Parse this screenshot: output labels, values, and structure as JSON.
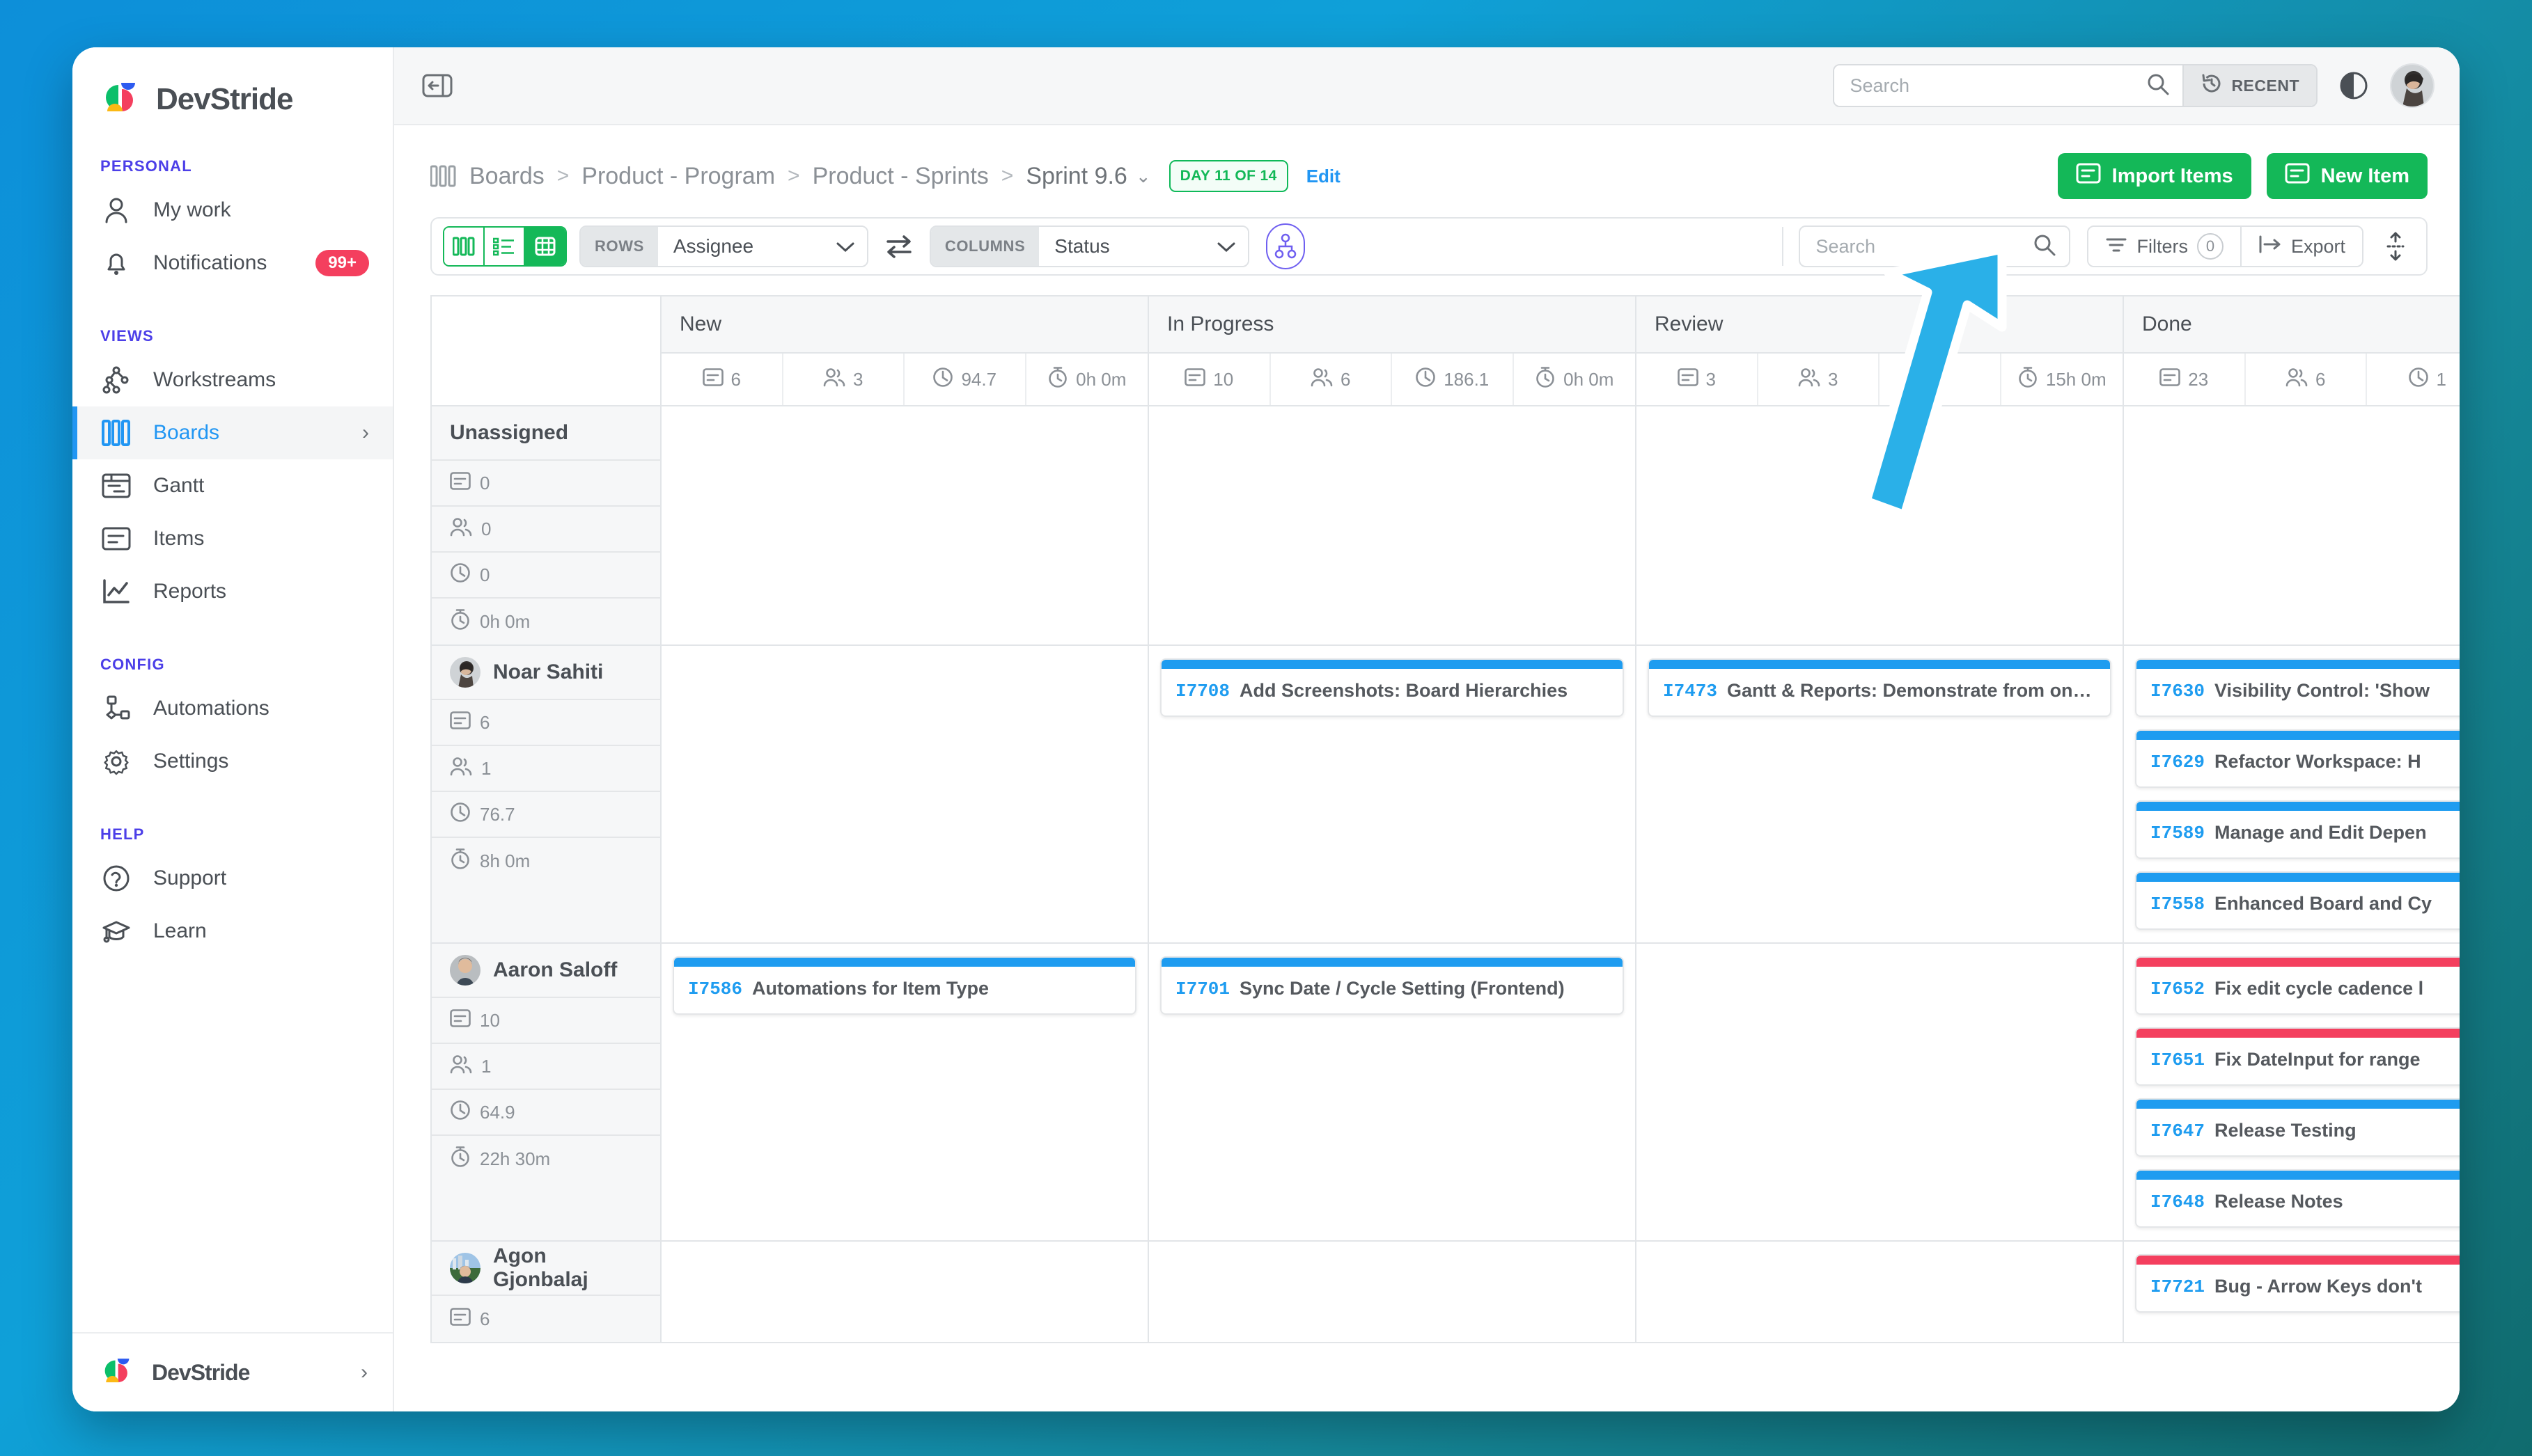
{
  "sidebar": {
    "brand": "DevStride",
    "sections": [
      {
        "label": "PERSONAL",
        "items": [
          {
            "label": "My work",
            "icon": "user-icon",
            "badge": null,
            "active": false,
            "chevron": false
          },
          {
            "label": "Notifications",
            "icon": "bell-icon",
            "badge": "99+",
            "active": false,
            "chevron": false
          }
        ]
      },
      {
        "label": "VIEWS",
        "items": [
          {
            "label": "Workstreams",
            "icon": "workstreams-icon",
            "badge": null,
            "active": false,
            "chevron": false
          },
          {
            "label": "Boards",
            "icon": "boards-icon",
            "badge": null,
            "active": true,
            "chevron": true
          },
          {
            "label": "Gantt",
            "icon": "gantt-icon",
            "badge": null,
            "active": false,
            "chevron": false
          },
          {
            "label": "Items",
            "icon": "items-icon",
            "badge": null,
            "active": false,
            "chevron": false
          },
          {
            "label": "Reports",
            "icon": "reports-icon",
            "badge": null,
            "active": false,
            "chevron": false
          }
        ]
      },
      {
        "label": "CONFIG",
        "items": [
          {
            "label": "Automations",
            "icon": "automations-icon",
            "badge": null,
            "active": false,
            "chevron": false
          },
          {
            "label": "Settings",
            "icon": "gear-icon",
            "badge": null,
            "active": false,
            "chevron": false
          }
        ]
      },
      {
        "label": "HELP",
        "items": [
          {
            "label": "Support",
            "icon": "question-circle-icon",
            "badge": null,
            "active": false,
            "chevron": false
          },
          {
            "label": "Learn",
            "icon": "graduation-cap-icon",
            "badge": null,
            "active": false,
            "chevron": false
          }
        ]
      }
    ],
    "footer": {
      "workspace": "DevStride"
    }
  },
  "topbar": {
    "search_placeholder": "Search",
    "search_value": "",
    "recent_label": "RECENT"
  },
  "breadcrumb": {
    "items": [
      "Boards",
      "Product - Program",
      "Product - Sprints",
      "Sprint 9.6"
    ],
    "separator": ">",
    "caret": "⌄",
    "day_badge": "DAY 11 OF 14",
    "edit_label": "Edit"
  },
  "actions": {
    "import_label": "Import Items",
    "new_item_label": "New Item"
  },
  "toolbar": {
    "rows_label": "ROWS",
    "rows_value": "Assignee",
    "columns_label": "COLUMNS",
    "columns_value": "Status",
    "search_placeholder": "Search",
    "search_value": "",
    "filters_label": "Filters",
    "filters_count": "0",
    "export_label": "Export",
    "view_modes": [
      "board-view",
      "list-view",
      "grid-view"
    ],
    "active_view": "grid-view"
  },
  "board": {
    "columns": [
      {
        "name": "New",
        "stats": {
          "items": "6",
          "people": "3",
          "points": "94.7",
          "time": "0h 0m"
        }
      },
      {
        "name": "In Progress",
        "stats": {
          "items": "10",
          "people": "6",
          "points": "186.1",
          "time": "0h 0m"
        }
      },
      {
        "name": "Review",
        "stats": {
          "items": "3",
          "people": "3",
          "points": "",
          "time": "15h 0m"
        }
      },
      {
        "name": "Done",
        "stats": {
          "items": "23",
          "people": "6",
          "points": "1",
          "time": ""
        }
      }
    ],
    "rows": [
      {
        "name": "Unassigned",
        "has_avatar": false,
        "stats": {
          "items": "0",
          "people": "0",
          "points": "0",
          "time": "0h 0m"
        },
        "cards": {
          "New": [],
          "In Progress": [],
          "Review": [],
          "Done": []
        }
      },
      {
        "name": "Noar Sahiti",
        "has_avatar": true,
        "stats": {
          "items": "6",
          "people": "1",
          "points": "76.7",
          "time": "8h 0m"
        },
        "cards": {
          "New": [],
          "In Progress": [
            {
              "id": "I7708",
              "title": "Add Screenshots: Board Hierarchies",
              "color": "#1e9cf0"
            }
          ],
          "Review": [
            {
              "id": "I7473",
              "title": "Gantt & Reports: Demonstrate from one of o...",
              "color": "#1e9cf0"
            }
          ],
          "Done": [
            {
              "id": "I7630",
              "title": "Visibility Control: 'Show",
              "color": "#1e9cf0"
            },
            {
              "id": "I7629",
              "title": "Refactor Workspace: H",
              "color": "#1e9cf0"
            },
            {
              "id": "I7589",
              "title": "Manage and Edit Depen",
              "color": "#1e9cf0"
            },
            {
              "id": "I7558",
              "title": "Enhanced Board and Cy",
              "color": "#1e9cf0"
            }
          ]
        }
      },
      {
        "name": "Aaron Saloff",
        "has_avatar": true,
        "stats": {
          "items": "10",
          "people": "1",
          "points": "64.9",
          "time": "22h 30m"
        },
        "cards": {
          "New": [
            {
              "id": "I7586",
              "title": "Automations for Item Type",
              "color": "#1e9cf0"
            }
          ],
          "In Progress": [
            {
              "id": "I7701",
              "title": "Sync Date / Cycle Setting (Frontend)",
              "color": "#1e9cf0"
            }
          ],
          "Review": [],
          "Done": [
            {
              "id": "I7652",
              "title": "Fix edit cycle cadence l",
              "color": "#f43f5e"
            },
            {
              "id": "I7651",
              "title": "Fix DateInput for range",
              "color": "#f43f5e"
            },
            {
              "id": "I7647",
              "title": "Release Testing",
              "color": "#1e9cf0"
            },
            {
              "id": "I7648",
              "title": "Release Notes",
              "color": "#1e9cf0"
            }
          ]
        }
      },
      {
        "name": "Agon Gjonbalaj",
        "has_avatar": true,
        "stats": {
          "items": "6",
          "people": "",
          "points": "",
          "time": ""
        },
        "cards": {
          "New": [],
          "In Progress": [],
          "Review": [],
          "Done": [
            {
              "id": "I7721",
              "title": "Bug - Arrow Keys don't",
              "color": "#f43f5e"
            }
          ]
        }
      }
    ]
  },
  "colors": {
    "accent_green": "#14b858",
    "accent_blue": "#1e9cf0",
    "accent_red": "#f43f5e",
    "accent_purple": "#4c3fe8",
    "annotation_arrow": "#2ab0e8"
  }
}
